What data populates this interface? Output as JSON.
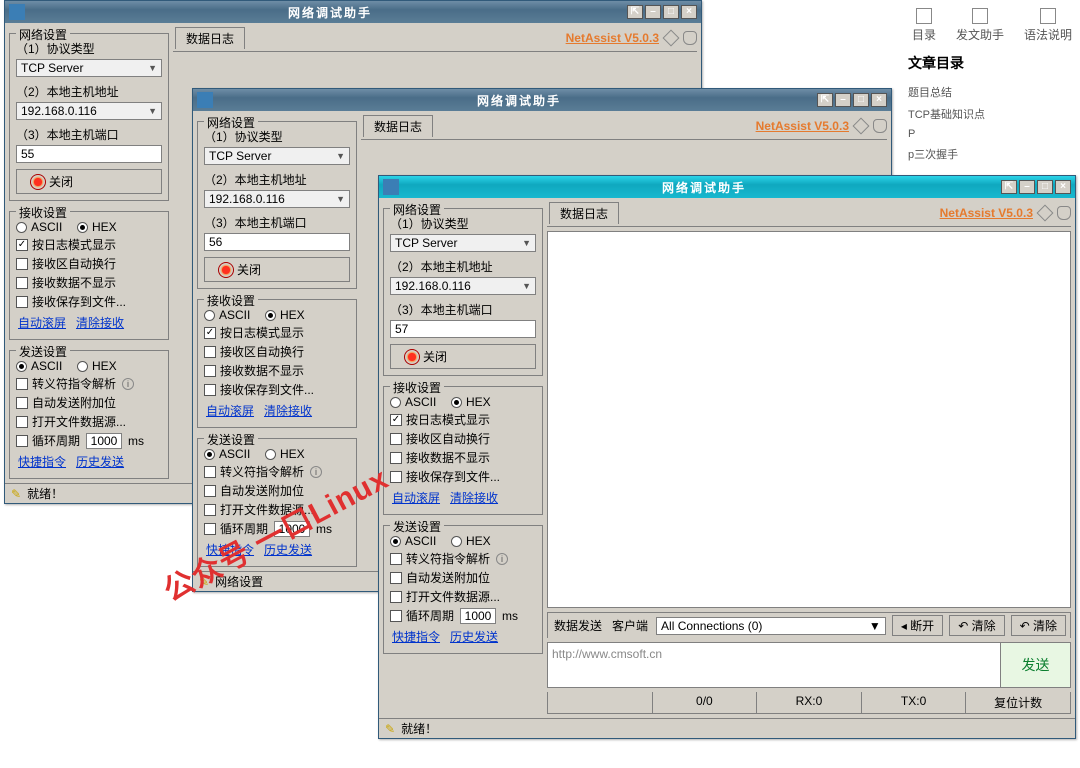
{
  "windows": [
    {
      "port": "55",
      "host": "192.168.0.116",
      "proto": "TCP Server"
    },
    {
      "port": "56",
      "host": "192.168.0.116",
      "proto": "TCP Server"
    },
    {
      "port": "57",
      "host": "192.168.0.116",
      "proto": "TCP Server"
    }
  ],
  "title": "网络调试助手",
  "brand": "NetAssist V5.0.3",
  "groups": {
    "net": "网络设置",
    "recv": "接收设置",
    "send": "发送设置",
    "proto": "（1）协议类型",
    "host": "（2）本地主机地址",
    "port": "（3）本地主机端口",
    "close": "关闭",
    "log_tab": "数据日志"
  },
  "radios": {
    "ascii": "ASCII",
    "hex": "HEX"
  },
  "checks": {
    "log_mode": "按日志模式显示",
    "auto_wrap": "接收区自动换行",
    "no_show": "接收数据不显示",
    "save_file": "接收保存到文件...",
    "escape": "转义符指令解析",
    "auto_send": "自动发送附加位",
    "open_file": "打开文件数据源...",
    "period": "循环周期",
    "period_val": "1000",
    "period_unit": "ms"
  },
  "links": {
    "auto_scroll": "自动滚屏",
    "clear_recv": "清除接收",
    "quick_cmd": "快捷指令",
    "history": "历史发送"
  },
  "status": {
    "ready": "就绪！",
    "net_set": "网络设置"
  },
  "front": {
    "send_label": "数据发送",
    "client_label": "客户端",
    "conn": "All Connections (0)",
    "disconnect": "断开",
    "clear": "清除",
    "send_text": "http://www.cmsoft.cn",
    "send_btn": "发送",
    "cells": [
      "",
      "0/0",
      "RX:0",
      "TX:0",
      "复位计数"
    ]
  },
  "sidebar": {
    "icons": [
      "目录",
      "发文助手",
      "语法说明"
    ],
    "title": "文章目录",
    "items": [
      "题目总结",
      "TCP基础知识点",
      "P",
      "p三次握手"
    ]
  },
  "watermark": "公众号  一口Linux"
}
